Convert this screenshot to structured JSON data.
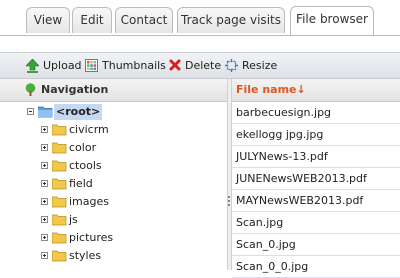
{
  "tabs": [
    {
      "label": "View",
      "active": false
    },
    {
      "label": "Edit",
      "active": false
    },
    {
      "label": "Contact",
      "active": false
    },
    {
      "label": "Track page visits",
      "active": false
    },
    {
      "label": "File browser",
      "active": true
    }
  ],
  "toolbar": {
    "upload_label": "Upload",
    "thumbnails_label": "Thumbnails",
    "delete_label": "Delete",
    "resize_label": "Resize"
  },
  "navigation": {
    "title": "Navigation",
    "root_label": "<root>",
    "folders": [
      "civicrm",
      "color",
      "ctools",
      "field",
      "images",
      "js",
      "pictures",
      "styles"
    ]
  },
  "files": {
    "column_header": "File name↓",
    "items": [
      "barbecuesign.jpg",
      "ekellogg jpg.jpg",
      "JULYNews-13.pdf",
      "JUNENewsWEB2013.pdf",
      "MAYNewsWEB2013.pdf",
      "Scan.jpg",
      "Scan_0.jpg",
      "Scan_0_0.jpg"
    ]
  },
  "colors": {
    "accent_header": "#e2571e",
    "folder_yellow": "#f2c84b",
    "root_folder_blue": "#5aa0dc",
    "selected_root_bg": "#c5d8f1"
  },
  "icons": {
    "upload": "upload-icon",
    "thumbnails": "thumbnails-icon",
    "delete": "delete-icon",
    "resize": "resize-icon",
    "navigation": "tree-icon",
    "folder": "folder-icon"
  }
}
